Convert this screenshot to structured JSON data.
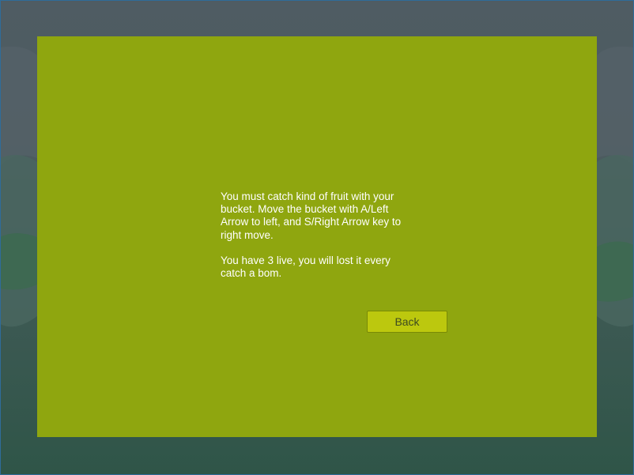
{
  "instructions": {
    "paragraph_1": "You must catch kind of fruit with your bucket. Move the bucket with A/Left Arrow to left, and S/Right Arrow key to right move.",
    "paragraph_2": "You have 3 live, you will lost it every catch a bom."
  },
  "buttons": {
    "back_label": "Back"
  },
  "colors": {
    "panel": "#8fa60f",
    "button": "#bcc80e",
    "text": "#ffffff"
  }
}
